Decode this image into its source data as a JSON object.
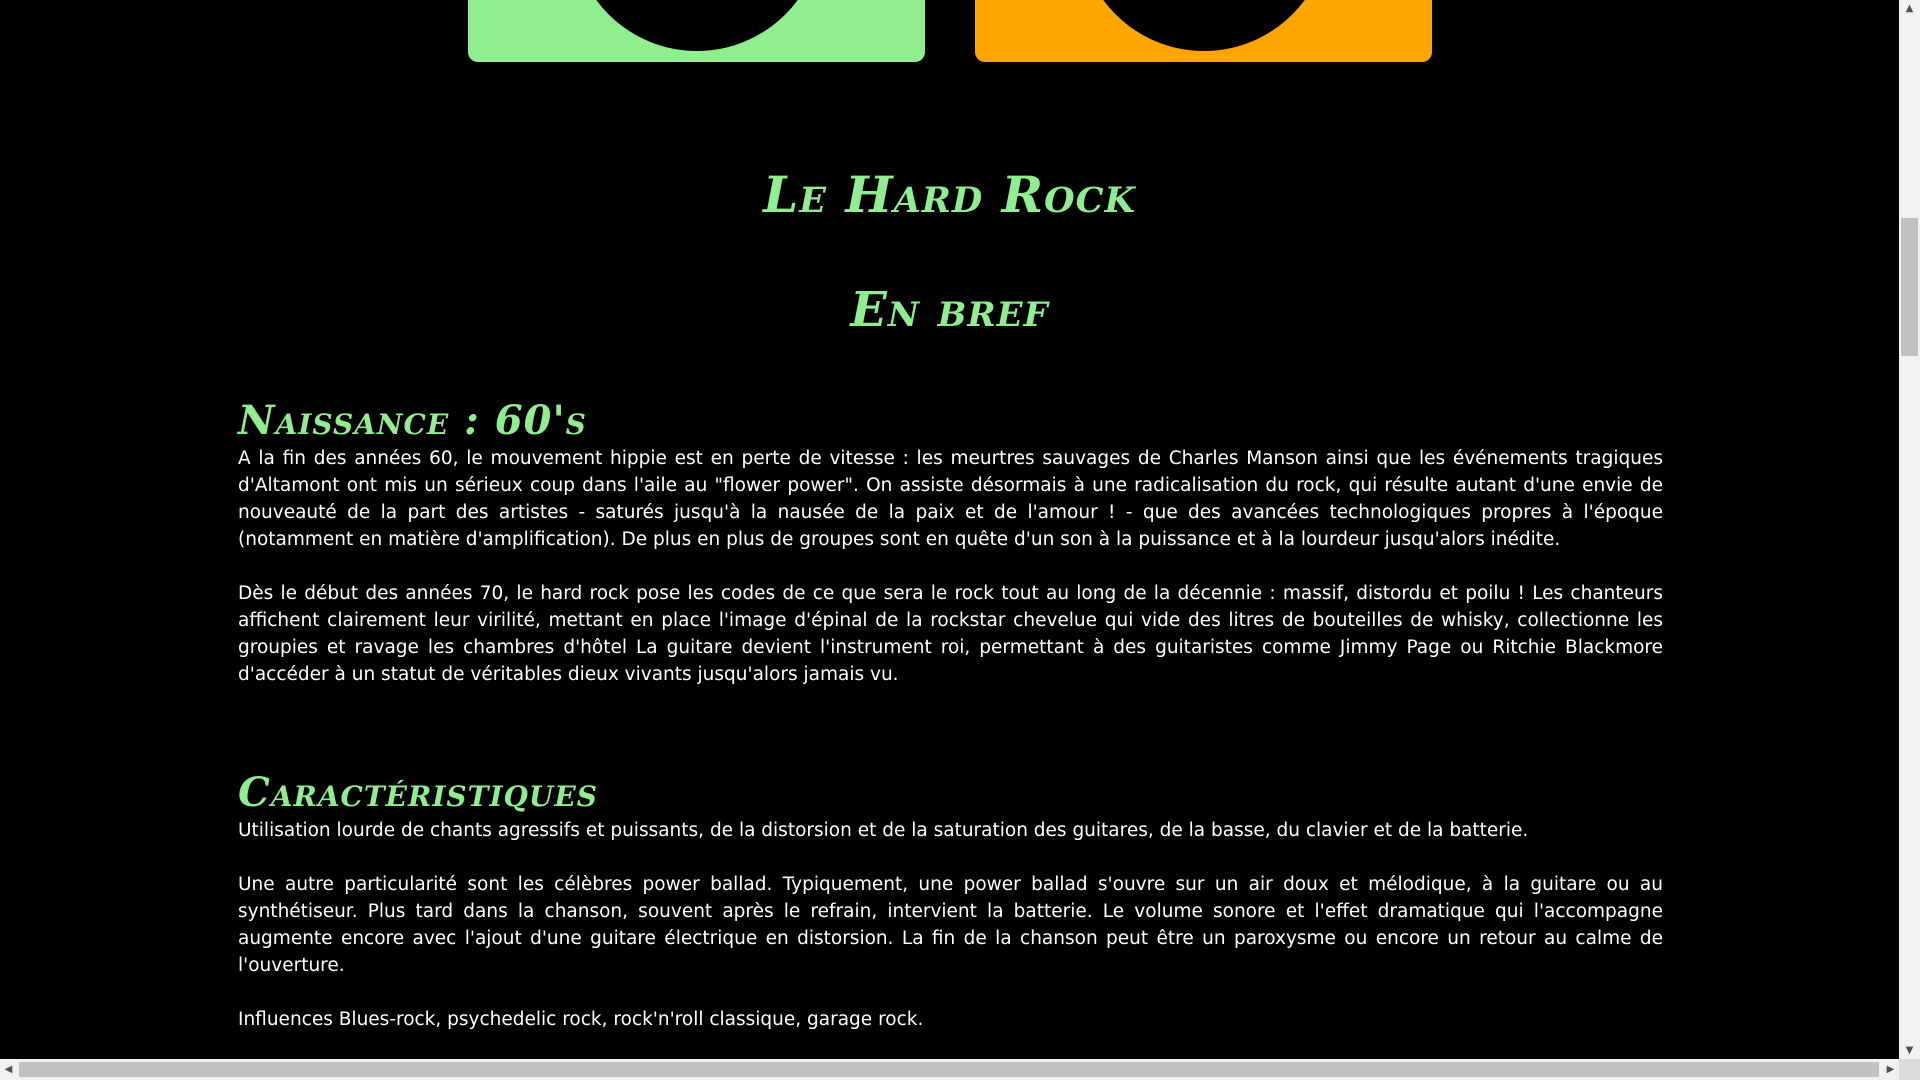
{
  "colors": {
    "accent": "#90ee90",
    "card_green": "#90ee90",
    "card_orange": "#ffa500",
    "background": "#000000",
    "text": "#ffffff"
  },
  "page": {
    "title": "Le Hard Rock",
    "subtitle": "En bref"
  },
  "sections": [
    {
      "heading": "Naissance : 60's",
      "paragraphs": [
        "A la fin des années 60, le mouvement hippie est en perte de vitesse : les meurtres sauvages de Charles Manson ainsi que les événements tragiques d'Altamont ont mis un sérieux coup dans l'aile au \"flower power\". On assiste désormais à une radicalisation du rock, qui résulte autant d'une envie de nouveauté de la part des artistes - saturés jusqu'à la nausée de la paix et de l'amour ! - que des avancées technologiques propres à l'époque (notamment en matière d'amplification). De plus en plus de groupes sont en quête d'un son à la puissance et à la lourdeur jusqu'alors inédite.",
        "Dès le début des années 70, le hard rock pose les codes de ce que sera le rock tout au long de la décennie : massif, distordu et poilu ! Les chanteurs affichent clairement leur virilité, mettant en place l'image d'épinal de la rockstar chevelue qui vide des litres de bouteilles de whisky, collectionne les groupies et ravage les chambres d'hôtel La guitare devient l'instrument roi, permettant à des guitaristes comme Jimmy Page ou Ritchie Blackmore d'accéder à un statut de véritables dieux vivants jusqu'alors jamais vu."
      ]
    },
    {
      "heading": "Caractéristiques",
      "paragraphs": [
        "Utilisation lourde de chants agressifs et puissants, de la distorsion et de la saturation des guitares, de la basse, du clavier et de la batterie.",
        "Une autre particularité sont les célèbres power ballad. Typiquement, une power ballad s'ouvre sur un air doux et mélodique, à la guitare ou au synthétiseur. Plus tard dans la chanson, souvent après le refrain, intervient la batterie. Le volume sonore et l'effet dramatique qui l'accompagne augmente encore avec l'ajout d'une guitare électrique en distorsion. La fin de la chanson peut être un paroxysme ou encore un retour au calme de l'ouverture.",
        "Influences Blues-rock, psychedelic rock, rock'n'roll classique, garage rock."
      ]
    }
  ],
  "icons": {
    "scroll_up": "▲",
    "scroll_down": "▼",
    "scroll_left": "◀",
    "scroll_right": "▶"
  }
}
